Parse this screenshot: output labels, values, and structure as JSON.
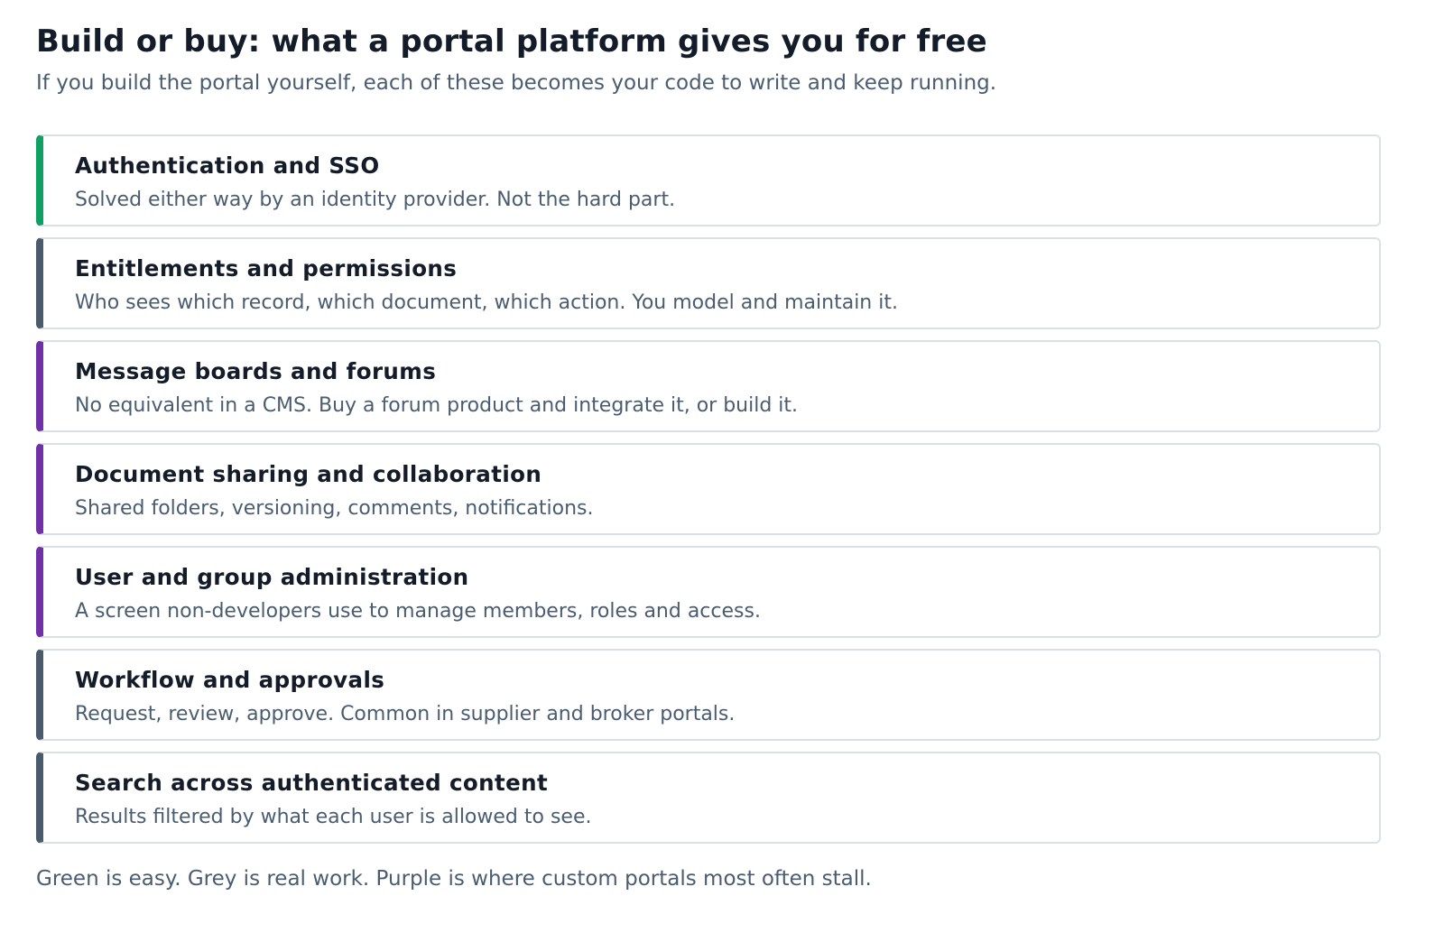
{
  "header": {
    "title": "Build or buy: what a portal platform gives you for free",
    "subtitle": "If you build the portal yourself, each of these becomes your code to write and keep running."
  },
  "colors": {
    "green": "#10a064",
    "grey": "#4a5b6b",
    "purple": "#7030a8"
  },
  "items": [
    {
      "title": "Authentication and SSO",
      "description": "Solved either way by an identity provider. Not the hard part.",
      "category": "green"
    },
    {
      "title": "Entitlements and permissions",
      "description": "Who sees which record, which document, which action. You model and maintain it.",
      "category": "grey"
    },
    {
      "title": "Message boards and forums",
      "description": "No equivalent in a CMS. Buy a forum product and integrate it, or build it.",
      "category": "purple"
    },
    {
      "title": "Document sharing and collaboration",
      "description": "Shared folders, versioning, comments, notifications.",
      "category": "purple"
    },
    {
      "title": "User and group administration",
      "description": "A screen non-developers use to manage members, roles and access.",
      "category": "purple"
    },
    {
      "title": "Workflow and approvals",
      "description": "Request, review, approve. Common in supplier and broker portals.",
      "category": "grey"
    },
    {
      "title": "Search across authenticated content",
      "description": "Results filtered by what each user is allowed to see.",
      "category": "grey"
    }
  ],
  "footnote": "Green is easy. Grey is real work. Purple is where custom portals most often stall."
}
